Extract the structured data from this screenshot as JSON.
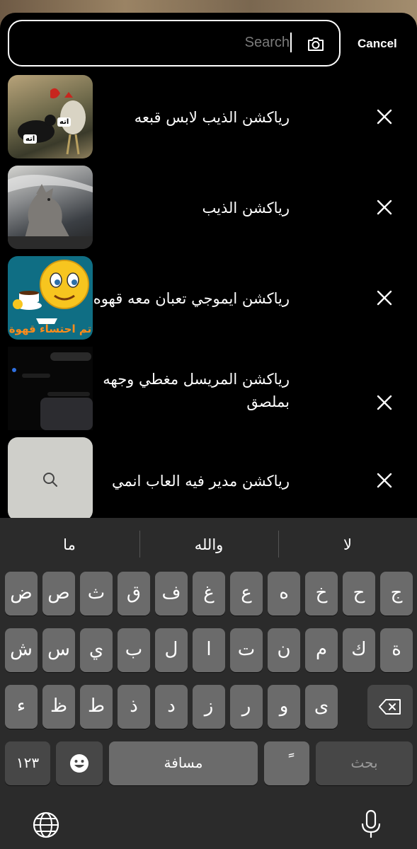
{
  "search": {
    "placeholder": "Search",
    "cancel_label": "Cancel"
  },
  "history": [
    {
      "text": "رياكشن الذيب  لابس قبعه",
      "thumb_label_1": "اته",
      "thumb_label_2": "اته"
    },
    {
      "text": "رياكشن الذيب"
    },
    {
      "text": "رياكشن ايموجي تعبان معه قهوه",
      "thumb_caption": "تم احتساء قهوة"
    },
    {
      "text": "رياكشن المريسل مغطي وجهه بملصق"
    },
    {
      "text": "رياكشن مدير فيه العاب انمي"
    }
  ],
  "keyboard": {
    "suggestions": [
      "ما",
      "والله",
      "لا"
    ],
    "row1": [
      "ض",
      "ص",
      "ث",
      "ق",
      "ف",
      "غ",
      "ع",
      "ه",
      "خ",
      "ح",
      "ج"
    ],
    "row2": [
      "ش",
      "س",
      "ي",
      "ب",
      "ل",
      "ا",
      "ت",
      "ن",
      "م",
      "ك",
      "ة"
    ],
    "row3": [
      "ء",
      "ظ",
      "ط",
      "ذ",
      "د",
      "ز",
      "ر",
      "و",
      "ى"
    ],
    "numbers_label": "١٢٣",
    "space_label": "مسافة",
    "tanween_label": "ً",
    "search_label": "بحث"
  },
  "colors": {
    "key": "#6b6b6b",
    "key_dark": "#474747",
    "keyboard_bg": "#2b2b2b"
  }
}
